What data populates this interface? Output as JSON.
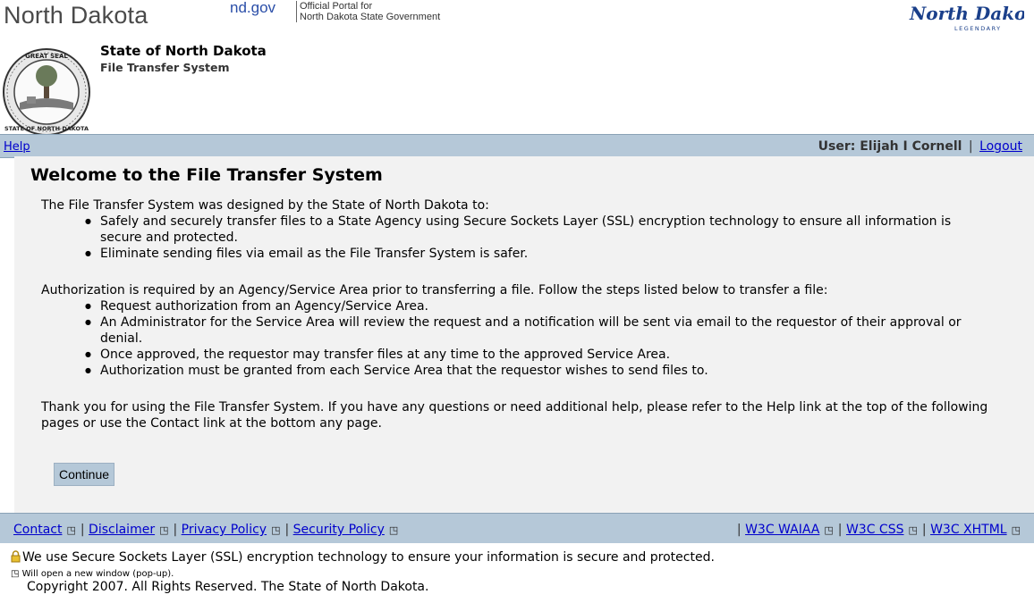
{
  "topbar": {
    "site_title": "North Dakota",
    "ndgov": "nd.gov",
    "portal_line1": "Official Portal for",
    "portal_line2": "North Dakota State Government",
    "legendary_logo": "North Dakota LEGENDARY"
  },
  "header": {
    "seal_text": "GREAT SEAL STATE OF NORTH DAKOTA",
    "state_name": "State of North Dakota",
    "system_name": "File Transfer System"
  },
  "nav": {
    "help": "Help",
    "user_label": "User: Elijah I Cornell",
    "separator": "|",
    "logout": "Logout"
  },
  "main": {
    "heading": "Welcome to the File Transfer System",
    "intro": "The File Transfer System was designed by the State of North Dakota to:",
    "intro_bullets": [
      "Safely and securely transfer files to a State Agency using Secure Sockets Layer (SSL) encryption technology to ensure all information is secure and protected.",
      "Eliminate sending files via email as the File Transfer System is safer."
    ],
    "auth_intro": "Authorization is required by an Agency/Service Area prior to transferring a file. Follow the steps listed below to transfer a file:",
    "auth_bullets": [
      "Request authorization from an Agency/Service Area.",
      "An Administrator for the Service Area will review the request and a notification will be sent via email to the requestor of their approval or denial.",
      "Once approved, the requestor may transfer files at any time to the approved Service Area.",
      "Authorization must be granted from each Service Area that the requestor wishes to send files to."
    ],
    "thanks": "Thank you for using the File Transfer System. If you have any questions or need additional help, please refer to the Help link at the top of the following pages or use the Contact link at the bottom any page.",
    "continue_label": "Continue"
  },
  "footer": {
    "contact": "Contact",
    "disclaimer": "Disclaimer",
    "privacy": "Privacy Policy",
    "security": "Security Policy",
    "w3c_waiaa": "W3C WAIAA",
    "w3c_css": "W3C CSS",
    "w3c_xhtml": "W3C XHTML",
    "separator": "|"
  },
  "bottom": {
    "ssl_note": "We use Secure Sockets Layer (SSL) encryption technology to ensure your information is secure and protected.",
    "new_window_note": "Will open a new window (pop-up).",
    "copyright": "Copyright 2007. All Rights Reserved. The State of North Dakota."
  },
  "colors": {
    "nav_bg": "#b5c8d8",
    "content_bg": "#f2f2f2",
    "link": "#0000cc"
  },
  "icons": {
    "popup": "popup-window-icon",
    "lock": "lock-icon",
    "seal": "state-seal-icon"
  }
}
